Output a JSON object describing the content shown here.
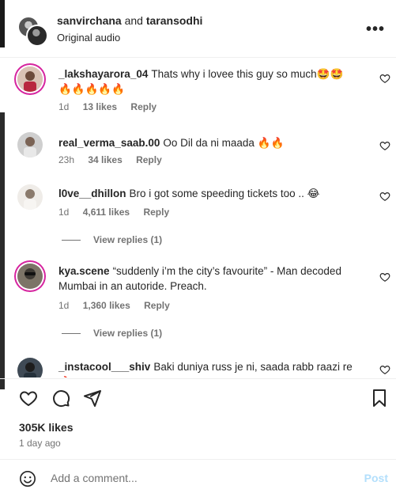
{
  "header": {
    "user1": "sanvirchana",
    "and_text": "and",
    "user2": "taransodhi",
    "audio": "Original audio",
    "more": "•••"
  },
  "comments": [
    {
      "username": "_lakshayarora_04",
      "text": "Thats why i lovee this guy so much🤩🤩🔥🔥🔥🔥🔥",
      "time": "1d",
      "likes": "13 likes",
      "reply": "Reply"
    },
    {
      "username": "real_verma_saab.00",
      "text": "Oo Dil da ni maada 🔥🔥",
      "time": "23h",
      "likes": "34 likes",
      "reply": "Reply"
    },
    {
      "username": "l0ve__dhillon",
      "text": "Bro i got some speeding tickets too .. 😂",
      "time": "1d",
      "likes": "4,611 likes",
      "reply": "Reply",
      "view_replies": "View replies (1)"
    },
    {
      "username": "kya.scene",
      "text": "“suddenly i’m the city’s favourite” - Man decoded Mumbai in an autoride. Preach.",
      "time": "1d",
      "likes": "1,360 likes",
      "reply": "Reply",
      "view_replies": "View replies (1)"
    },
    {
      "username": "_instacool___shiv",
      "text": "Baki duniya russ je ni, saada rabb raazi re 🔥"
    }
  ],
  "post": {
    "likes": "305K likes",
    "date": "1 day ago"
  },
  "add_comment": {
    "placeholder": "Add a comment...",
    "post_label": "Post"
  },
  "colors": {
    "text": "#262626",
    "secondary": "#737373",
    "post_disabled": "#b2dffc",
    "story_ring": "#d6249f"
  }
}
